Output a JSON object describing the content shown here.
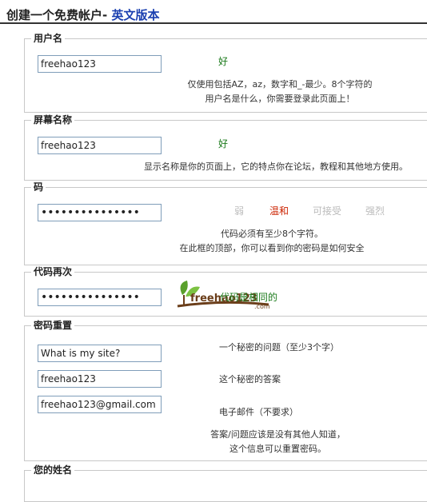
{
  "page": {
    "title": "创建一个免费帐户",
    "title_sep": "-",
    "english_link": "英文版本"
  },
  "sections": {
    "username": {
      "legend": "用户名",
      "value": "freehao123",
      "status": "好",
      "hint_line1": "仅使用包括AZ，az，数字和_-最少。8个字符的",
      "hint_line2": "用户名是什么，你需要登录此页面上！"
    },
    "screen_name": {
      "legend": "屏幕名称",
      "value": "freehao123",
      "status": "好",
      "hint": "显示名称是你的页面上，它的特点你在论坛，教程和其他地方使用。"
    },
    "password": {
      "legend": "码",
      "value": "•••••••••••••••",
      "strength": [
        "弱",
        "温和",
        "可接受",
        "强烈"
      ],
      "hint_line1": "代码必须有至少8个字符。",
      "hint_line2": "在此框的顶部，你可以看到你的密码是如何安全"
    },
    "password_again": {
      "legend": "代码再次",
      "value": "•••••••••••••••",
      "match_msg": "代码是相同的",
      "logo_text": "freehao123",
      "logo_suffix": ".com"
    },
    "reset": {
      "legend": "密码重置",
      "question_value": "What is my site?",
      "question_label": "一个秘密的问题（至少3个字）",
      "answer_value": "freehao123",
      "answer_label": "这个秘密的答案",
      "email_value": "freehao123@gmail.com",
      "email_label": "电子邮件（不要求）",
      "note_line1": "答案/问题应该是没有其他人知道，",
      "note_line2": "这个信息可以重置密码。"
    },
    "your_name": {
      "legend": "您的姓名"
    }
  },
  "colors": {
    "good": "#1a7a1a",
    "active_strength": "#cc2200",
    "link": "#1a3fb0",
    "input_border": "#7f9db9"
  }
}
